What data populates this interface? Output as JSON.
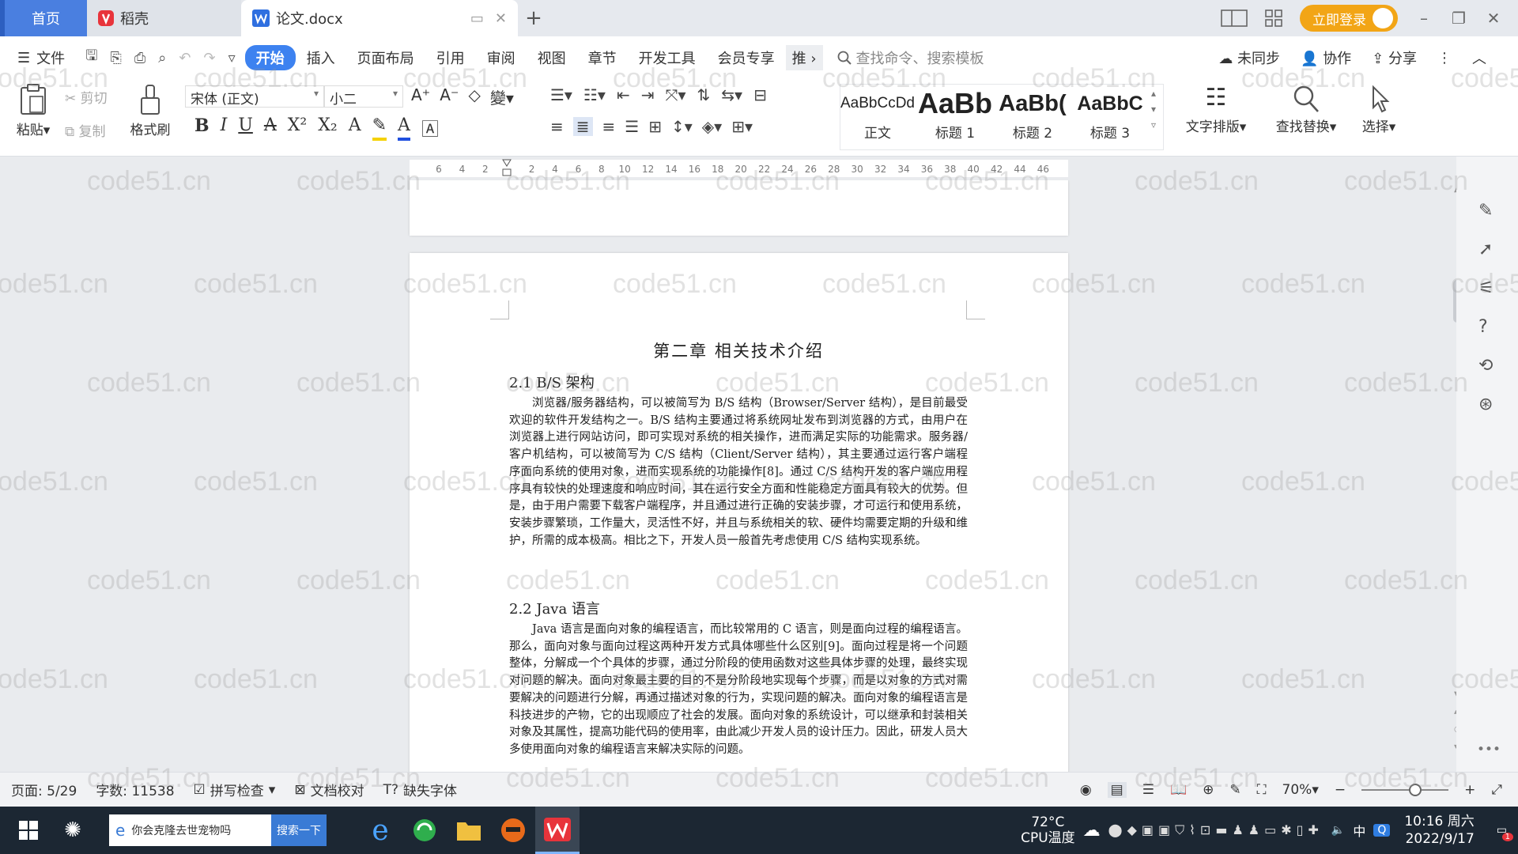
{
  "tabs": {
    "home": "首页",
    "daoke": "稻壳",
    "doc": "论文.docx"
  },
  "titlebar": {
    "login": "立即登录"
  },
  "menu": {
    "file": "文件",
    "items": [
      "开始",
      "插入",
      "页面布局",
      "引用",
      "审阅",
      "视图",
      "章节",
      "开发工具",
      "会员专享",
      "推"
    ],
    "search_cmd": "查找命令、搜索模板",
    "unsynced": "未同步",
    "collab": "协作",
    "share": "分享"
  },
  "ribbon": {
    "paste": "粘贴",
    "cut": "剪切",
    "copy": "复制",
    "format_painter": "格式刷",
    "font_name": "宋体 (正文)",
    "font_size": "小二",
    "styles": [
      {
        "preview": "AaBbCcDd",
        "label": "正文"
      },
      {
        "preview": "AaBb",
        "label": "标题 1"
      },
      {
        "preview": "AaBb(",
        "label": "标题 2"
      },
      {
        "preview": "AaBbC",
        "label": "标题 3"
      }
    ],
    "text_layout": "文字排版",
    "find_replace": "查找替换",
    "select": "选择"
  },
  "ruler": {
    "ticks": [
      "6",
      "4",
      "2",
      "",
      "2",
      "4",
      "6",
      "8",
      "10",
      "12",
      "14",
      "16",
      "18",
      "20",
      "22",
      "24",
      "26",
      "28",
      "30",
      "32",
      "34",
      "36",
      "38",
      "40",
      "42",
      "44",
      "46"
    ]
  },
  "document": {
    "chapter": "第二章  相关技术介绍",
    "s1_title": "2.1 B/S 架构",
    "s1_text": "浏览器/服务器结构，可以被简写为 B/S 结构（Browser/Server 结构），是目前最受欢迎的软件开发结构之一。B/S 结构主要通过将系统网址发布到浏览器的方式，由用户在浏览器上进行网站访问，即可实现对系统的相关操作，进而满足实际的功能需求。服务器/客户机结构，可以被简写为 C/S 结构（Client/Server 结构），其主要通过运行客户端程序面向系统的使用对象，进而实现系统的功能操作[8]。通过 C/S 结构开发的客户端应用程序具有较快的处理速度和响应时间，其在运行安全方面和性能稳定方面具有较大的优势。但是，由于用户需要下载客户端程序，并且通过进行正确的安装步骤，才可运行和使用系统，安装步骤繁琐，工作量大，灵活性不好，并且与系统相关的软、硬件均需要定期的升级和维护，所需的成本极高。相比之下，开发人员一般首先考虑使用 C/S 结构实现系统。",
    "s2_title": "2.2 Java 语言",
    "s2_text": "Java 语言是面向对象的编程语言，而比较常用的 C 语言，则是面向过程的编程语言。那么，面向对象与面向过程这两种开发方式具体哪些什么区别[9]。面向过程是将一个问题整体，分解成一个个具体的步骤，通过分阶段的使用函数对这些具体步骤的处理，最终实现对问题的解决。面向对象最主要的目的不是分阶段地实现每个步骤，而是以对象的方式对需要解决的问题进行分解，再通过描述对象的行为，实现问题的解决。面向对象的编程语言是科技进步的产物，它的出现顺应了社会的发展。面向对象的系统设计，可以继承和封装相关对象及其属性，提高功能代码的使用率，由此减少开发人员的设计压力。因此，研发人员大多使用面向对象的编程语言来解决实际的问题。"
  },
  "status": {
    "page": "页面: 5/29",
    "words": "字数: 11538",
    "spell": "拼写检查",
    "proof": "文档校对",
    "missing_font": "缺失字体",
    "zoom": "70%"
  },
  "taskbar": {
    "search_text": "你会克隆去世宠物吗",
    "search_btn": "搜索一下",
    "temp": "72°C",
    "temp_label": "CPU温度",
    "ime": "中",
    "time": "10:16 周六",
    "date": "2022/9/17",
    "notif": "1"
  },
  "watermark": "code51.cn",
  "colors": {
    "accent": "#3d82f0",
    "home_tab": "#4a7fe0",
    "login": "#f2a516",
    "taskbar": "#1c2733"
  }
}
